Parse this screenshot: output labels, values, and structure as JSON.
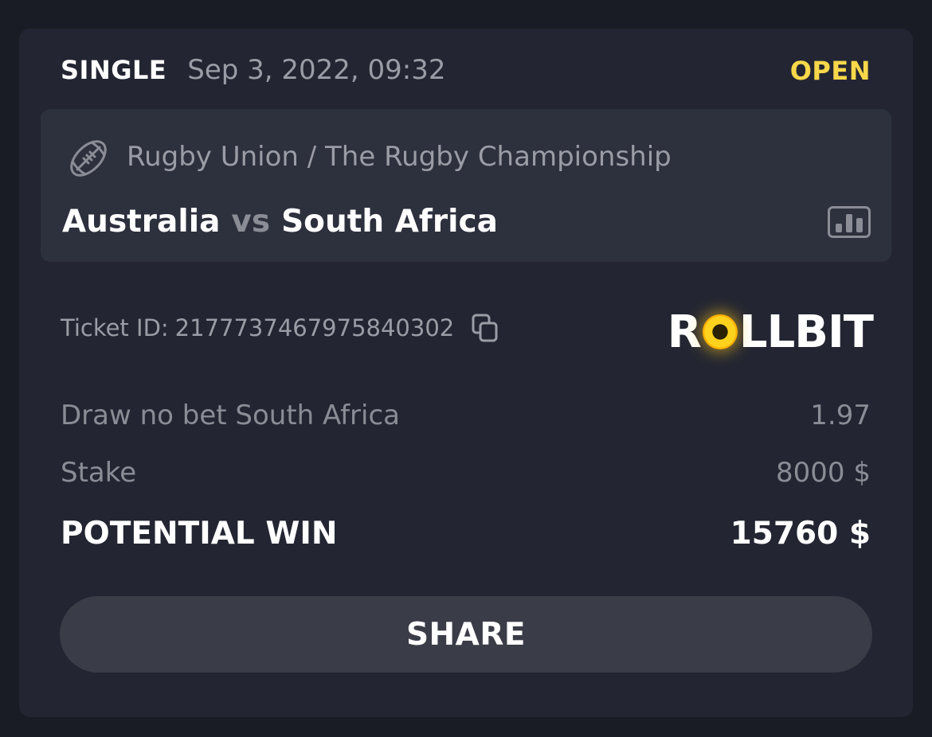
{
  "bet": {
    "type": "SINGLE",
    "date": "Sep 3, 2022, 09:32",
    "status": "OPEN",
    "status_color": "#f8d84a"
  },
  "event": {
    "sport_icon": "rugby-ball-icon",
    "league": "Rugby Union / The Rugby Championship",
    "home_team": "Australia",
    "vs": "vs",
    "away_team": "South Africa",
    "stats_icon": "bar-chart-icon"
  },
  "ticket": {
    "label": "Ticket ID:",
    "id": "2177737467975840302",
    "copy_icon": "copy-icon"
  },
  "brand": {
    "logo_prefix": "R",
    "logo_suffix": "LLBIT",
    "accent": "#ffd21e"
  },
  "selection": {
    "market": "Draw no bet South Africa",
    "odds": "1.97"
  },
  "stake": {
    "label": "Stake",
    "value": "8000 $"
  },
  "potential_win": {
    "label": "POTENTIAL WIN",
    "value": "15760 $"
  },
  "actions": {
    "share_label": "SHARE"
  }
}
